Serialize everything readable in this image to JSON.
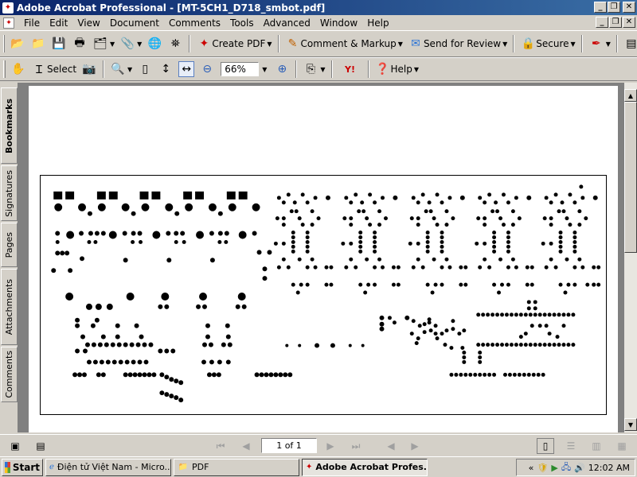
{
  "window": {
    "title": "Adobe Acrobat Professional - [MT-5CH1_D718_smbot.pdf]"
  },
  "menu": {
    "items": [
      "File",
      "Edit",
      "View",
      "Document",
      "Comments",
      "Tools",
      "Advanced",
      "Window",
      "Help"
    ]
  },
  "toolbar1": {
    "create_pdf": "Create PDF",
    "comment_markup": "Comment & Markup",
    "send_review": "Send for Review",
    "secure": "Secure"
  },
  "toolbar2": {
    "select": "Select",
    "zoom_value": "66%",
    "help": "Help"
  },
  "nav_tabs": [
    "Bookmarks",
    "Signatures",
    "Pages",
    "Attachments",
    "Comments"
  ],
  "status": {
    "page_indicator": "1 of 1"
  },
  "taskbar": {
    "start": "Start",
    "tasks": [
      "Điện tử Việt Nam - Micro...",
      "PDF",
      "Adobe Acrobat Profes..."
    ],
    "tray_expand": "«",
    "clock": "12:02 AM"
  },
  "colors": {
    "titlebar_start": "#0a246a",
    "titlebar_end": "#3a6ea5",
    "chrome": "#d4d0c8",
    "doc_background": "#808080"
  }
}
